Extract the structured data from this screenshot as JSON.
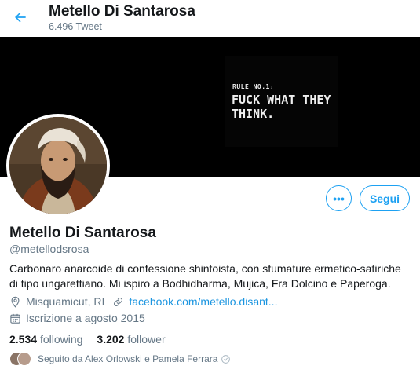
{
  "header": {
    "title": "Metello Di Santarosa",
    "tweet_count": "6.496 Tweet"
  },
  "banner": {
    "small_text": "RULE NO.1:",
    "big_text": "FUCK WHAT THEY THINK."
  },
  "actions": {
    "more_label": "•••",
    "follow_label": "Segui"
  },
  "profile": {
    "name": "Metello Di Santarosa",
    "handle": "@metellodsrosa",
    "bio": "Carbonaro anarcoide di confessione shintoista, con sfumature ermetico-satiriche di tipo ungarettiano. Mi ispiro a Bodhidharma, Mujica, Fra Dolcino e Paperoga.",
    "location": "Misquamicut, RI",
    "website": "facebook.com/metello.disant...",
    "joined": "Iscrizione a agosto 2015"
  },
  "stats": {
    "following_count": "2.534",
    "following_label": "following",
    "follower_count": "3.202",
    "follower_label": "follower"
  },
  "followed_by": {
    "text": "Seguito da Alex Orlowski e Pamela Ferrara"
  },
  "icons": {
    "back": "arrow-left-icon",
    "location": "location-pin-icon",
    "link": "link-icon",
    "calendar": "calendar-icon"
  },
  "colors": {
    "accent": "#1da1f2",
    "link": "#1b95e0",
    "secondary_text": "#657786",
    "banner": "#000000"
  }
}
